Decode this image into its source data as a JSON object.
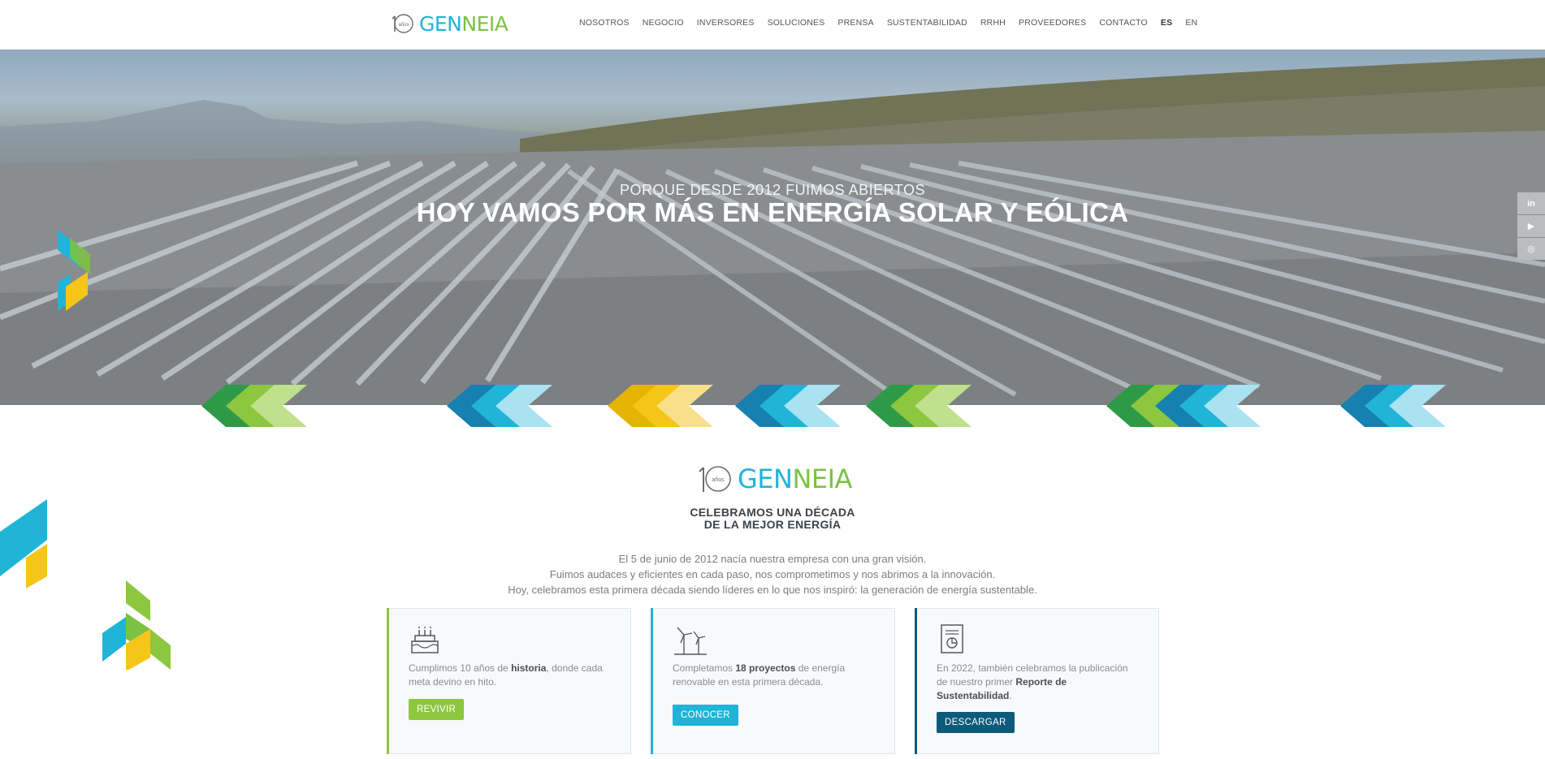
{
  "brand": {
    "logo_text_a": "GEN",
    "logo_text_b": "NEIA",
    "logo_badge": "años"
  },
  "nav": {
    "items": [
      "NOSOTROS",
      "NEGOCIO",
      "INVERSORES",
      "SOLUCIONES",
      "PRENSA",
      "SUSTENTABILIDAD",
      "RRHH",
      "PROVEEDORES",
      "CONTACTO",
      "ES",
      "EN"
    ],
    "active": "ES"
  },
  "hero": {
    "kicker": "PORQUE DESDE 2012 FUIMOS ABIERTOS",
    "title": "HOY VAMOS POR MÁS EN ENERGÍA SOLAR Y EÓLICA"
  },
  "social": {
    "items": [
      "in",
      "▶",
      "◎"
    ]
  },
  "decade": {
    "title_line1": "CELEBRAMOS UNA DÉCADA",
    "title_line2": "DE LA MEJOR ENERGÍA",
    "body_line1": "El 5 de junio de 2012 nacía nuestra empresa con una gran visión.",
    "body_line2": "Fuimos audaces y eficientes en cada paso, nos comprometimos y nos abrimos a la innovación.",
    "body_line3": "Hoy, celebramos esta primera década siendo líderes en lo que nos inspiró: la generación de energía sustentable."
  },
  "cards": [
    {
      "text_a": "Cumplimos 10 años de ",
      "text_bold": "historia",
      "text_b": ", donde cada meta devino en hito.",
      "button": "REVIVIR",
      "accent": "#8dc63f"
    },
    {
      "text_a": "Completamos ",
      "text_bold": "18 proyectos",
      "text_b": " de energía renovable en esta primera década.",
      "button": "CONOCER",
      "accent": "#1fb4d8"
    },
    {
      "text_a": "En 2022, también celebramos la publicación de nuestro primer ",
      "text_bold": "Reporte de Sustentabilidad",
      "text_b": ".",
      "button": "DESCARGAR",
      "accent": "#0d5a7a"
    }
  ],
  "colors": {
    "green": "#8dc63f",
    "cyan": "#1fb4d8",
    "yellow": "#f5c518",
    "navy": "#0d5a7a",
    "dark_green": "#2e9a47"
  }
}
